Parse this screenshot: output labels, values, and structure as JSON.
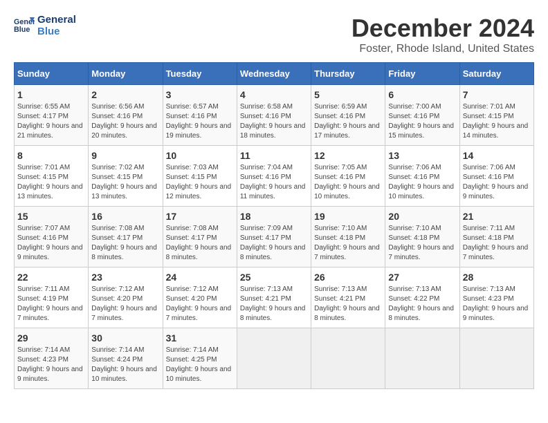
{
  "logo": {
    "line1": "General",
    "line2": "Blue"
  },
  "title": "December 2024",
  "subtitle": "Foster, Rhode Island, United States",
  "headers": [
    "Sunday",
    "Monday",
    "Tuesday",
    "Wednesday",
    "Thursday",
    "Friday",
    "Saturday"
  ],
  "weeks": [
    [
      {
        "day": "1",
        "sunrise": "6:55 AM",
        "sunset": "4:17 PM",
        "daylight": "9 hours and 21 minutes."
      },
      {
        "day": "2",
        "sunrise": "6:56 AM",
        "sunset": "4:16 PM",
        "daylight": "9 hours and 20 minutes."
      },
      {
        "day": "3",
        "sunrise": "6:57 AM",
        "sunset": "4:16 PM",
        "daylight": "9 hours and 19 minutes."
      },
      {
        "day": "4",
        "sunrise": "6:58 AM",
        "sunset": "4:16 PM",
        "daylight": "9 hours and 18 minutes."
      },
      {
        "day": "5",
        "sunrise": "6:59 AM",
        "sunset": "4:16 PM",
        "daylight": "9 hours and 17 minutes."
      },
      {
        "day": "6",
        "sunrise": "7:00 AM",
        "sunset": "4:16 PM",
        "daylight": "9 hours and 15 minutes."
      },
      {
        "day": "7",
        "sunrise": "7:01 AM",
        "sunset": "4:15 PM",
        "daylight": "9 hours and 14 minutes."
      }
    ],
    [
      {
        "day": "8",
        "sunrise": "7:01 AM",
        "sunset": "4:15 PM",
        "daylight": "9 hours and 13 minutes."
      },
      {
        "day": "9",
        "sunrise": "7:02 AM",
        "sunset": "4:15 PM",
        "daylight": "9 hours and 13 minutes."
      },
      {
        "day": "10",
        "sunrise": "7:03 AM",
        "sunset": "4:15 PM",
        "daylight": "9 hours and 12 minutes."
      },
      {
        "day": "11",
        "sunrise": "7:04 AM",
        "sunset": "4:16 PM",
        "daylight": "9 hours and 11 minutes."
      },
      {
        "day": "12",
        "sunrise": "7:05 AM",
        "sunset": "4:16 PM",
        "daylight": "9 hours and 10 minutes."
      },
      {
        "day": "13",
        "sunrise": "7:06 AM",
        "sunset": "4:16 PM",
        "daylight": "9 hours and 10 minutes."
      },
      {
        "day": "14",
        "sunrise": "7:06 AM",
        "sunset": "4:16 PM",
        "daylight": "9 hours and 9 minutes."
      }
    ],
    [
      {
        "day": "15",
        "sunrise": "7:07 AM",
        "sunset": "4:16 PM",
        "daylight": "9 hours and 9 minutes."
      },
      {
        "day": "16",
        "sunrise": "7:08 AM",
        "sunset": "4:17 PM",
        "daylight": "9 hours and 8 minutes."
      },
      {
        "day": "17",
        "sunrise": "7:08 AM",
        "sunset": "4:17 PM",
        "daylight": "9 hours and 8 minutes."
      },
      {
        "day": "18",
        "sunrise": "7:09 AM",
        "sunset": "4:17 PM",
        "daylight": "9 hours and 8 minutes."
      },
      {
        "day": "19",
        "sunrise": "7:10 AM",
        "sunset": "4:18 PM",
        "daylight": "9 hours and 7 minutes."
      },
      {
        "day": "20",
        "sunrise": "7:10 AM",
        "sunset": "4:18 PM",
        "daylight": "9 hours and 7 minutes."
      },
      {
        "day": "21",
        "sunrise": "7:11 AM",
        "sunset": "4:18 PM",
        "daylight": "9 hours and 7 minutes."
      }
    ],
    [
      {
        "day": "22",
        "sunrise": "7:11 AM",
        "sunset": "4:19 PM",
        "daylight": "9 hours and 7 minutes."
      },
      {
        "day": "23",
        "sunrise": "7:12 AM",
        "sunset": "4:20 PM",
        "daylight": "9 hours and 7 minutes."
      },
      {
        "day": "24",
        "sunrise": "7:12 AM",
        "sunset": "4:20 PM",
        "daylight": "9 hours and 7 minutes."
      },
      {
        "day": "25",
        "sunrise": "7:13 AM",
        "sunset": "4:21 PM",
        "daylight": "9 hours and 8 minutes."
      },
      {
        "day": "26",
        "sunrise": "7:13 AM",
        "sunset": "4:21 PM",
        "daylight": "9 hours and 8 minutes."
      },
      {
        "day": "27",
        "sunrise": "7:13 AM",
        "sunset": "4:22 PM",
        "daylight": "9 hours and 8 minutes."
      },
      {
        "day": "28",
        "sunrise": "7:13 AM",
        "sunset": "4:23 PM",
        "daylight": "9 hours and 9 minutes."
      }
    ],
    [
      {
        "day": "29",
        "sunrise": "7:14 AM",
        "sunset": "4:23 PM",
        "daylight": "9 hours and 9 minutes."
      },
      {
        "day": "30",
        "sunrise": "7:14 AM",
        "sunset": "4:24 PM",
        "daylight": "9 hours and 10 minutes."
      },
      {
        "day": "31",
        "sunrise": "7:14 AM",
        "sunset": "4:25 PM",
        "daylight": "9 hours and 10 minutes."
      },
      null,
      null,
      null,
      null
    ]
  ],
  "colors": {
    "header_bg": "#3a6fba",
    "header_text": "#ffffff",
    "accent": "#1a3c6e"
  }
}
